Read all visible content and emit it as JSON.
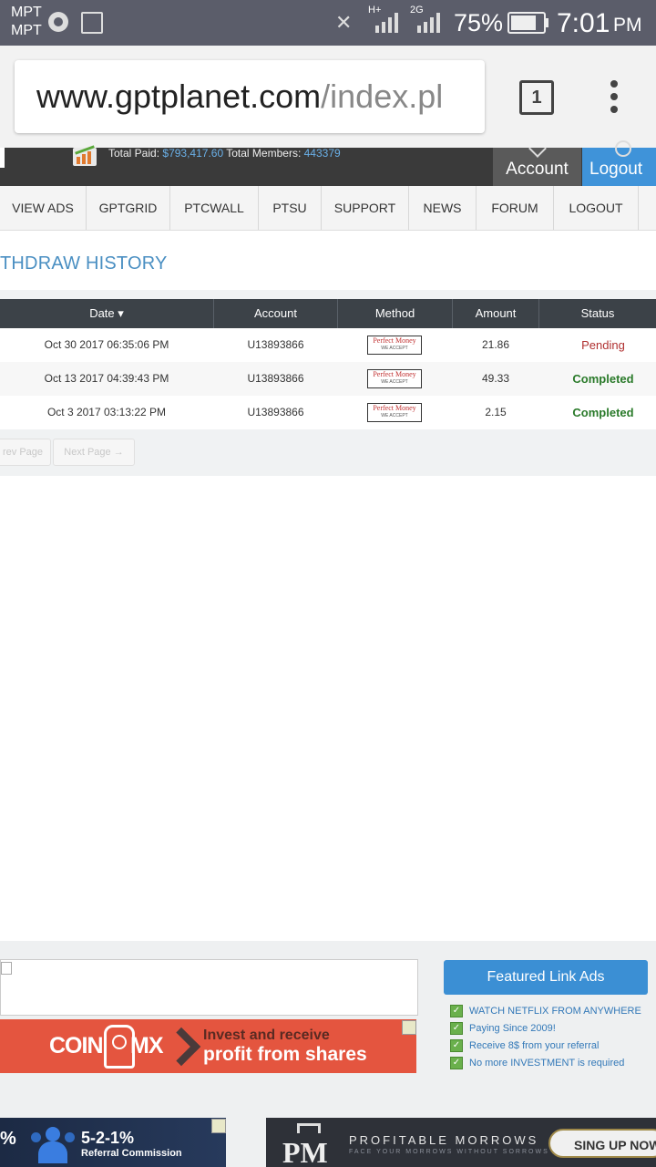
{
  "status_bar": {
    "carrier1": "MPT",
    "carrier2": "MPT",
    "network1": "H+",
    "network2": "2G",
    "battery": "75%",
    "time": "7:01",
    "ampm": "PM"
  },
  "browser": {
    "url_host": "www.gptplanet.com",
    "url_path": "/index.pl",
    "tab_count": "1"
  },
  "header": {
    "total_paid_label": "Total Paid:",
    "total_paid_value": "$793,417.60",
    "total_members_label": "Total Members:",
    "total_members_value": "443379",
    "account_label": "Account",
    "logout_label": "Logout"
  },
  "nav": {
    "items": [
      {
        "label": "VIEW ADS"
      },
      {
        "label": "GPTGRID"
      },
      {
        "label": "PTCWALL"
      },
      {
        "label": "PTSU"
      },
      {
        "label": "SUPPORT"
      },
      {
        "label": "NEWS"
      },
      {
        "label": "FORUM"
      },
      {
        "label": "LOGOUT"
      }
    ]
  },
  "page": {
    "title": "THDRAW HISTORY"
  },
  "table": {
    "headers": {
      "date": "Date ▾",
      "account": "Account",
      "method": "Method",
      "amount": "Amount",
      "status": "Status"
    },
    "rows": [
      {
        "date": "Oct 30 2017 06:35:06 PM",
        "account": "U13893866",
        "method": "Perfect Money",
        "amount": "21.86",
        "status": "Pending"
      },
      {
        "date": "Oct 13 2017 04:39:43 PM",
        "account": "U13893866",
        "method": "Perfect Money",
        "amount": "49.33",
        "status": "Completed"
      },
      {
        "date": "Oct 3 2017 03:13:22 PM",
        "account": "U13893866",
        "method": "Perfect Money",
        "amount": "2.15",
        "status": "Completed"
      }
    ],
    "method_logo_top": "Perfect Money",
    "method_logo_bottom": "WE ACCEPT",
    "prev_label": "rev Page",
    "next_label": "Next Page →"
  },
  "ads": {
    "coinmx_brand_left": "COIN",
    "coinmx_brand_right": "MX",
    "coinmx_line1": "Invest and receive",
    "coinmx_line2": "profit from shares",
    "referral_pct": "%",
    "referral_big": "5-2-1%",
    "referral_small": "Referral Commission",
    "pm_title": "PROFITABLE MORROWS",
    "pm_sub": "FACE YOUR MORROWS WITHOUT SORROWS",
    "pm_button": "SING UP NOW"
  },
  "featured": {
    "title": "Featured Link Ads",
    "items": [
      {
        "label": "WATCH NETFLIX FROM ANYWHERE"
      },
      {
        "label": "Paying Since 2009!"
      },
      {
        "label": "Receive 8$ from your referral"
      },
      {
        "label": "No more INVESTMENT is required"
      }
    ]
  },
  "colors": {
    "pending": "#b03030",
    "completed": "#2a7a2a",
    "accent": "#3b8fd4"
  }
}
